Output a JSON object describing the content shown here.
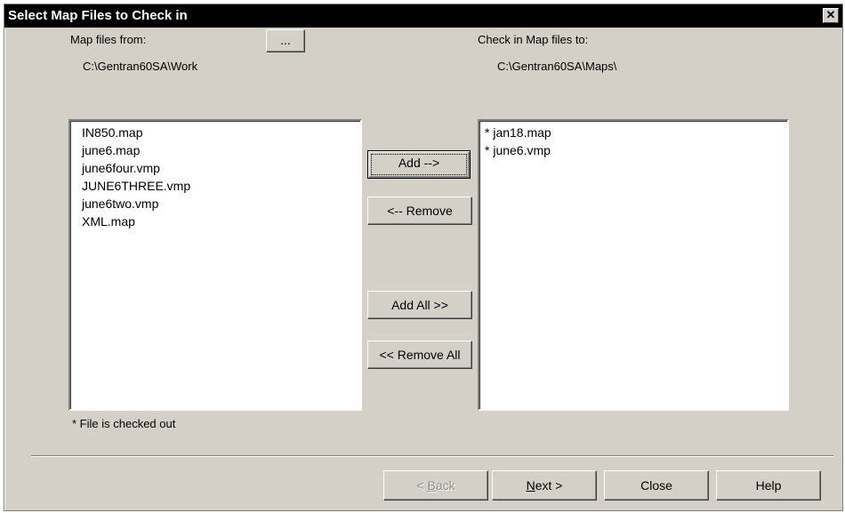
{
  "window": {
    "title": "Select Map Files to Check in",
    "close_glyph": "✕"
  },
  "source": {
    "label": "Map files from:",
    "browse_label": "...",
    "path": "C:\\Gentran60SA\\Work",
    "files": [
      "IN850.map",
      "june6.map",
      "june6four.vmp",
      "JUNE6THREE.vmp",
      "june6two.vmp",
      "XML.map"
    ]
  },
  "target": {
    "label": "Check in Map files to:",
    "path": "C:\\Gentran60SA\\Maps\\",
    "files": [
      "* jan18.map",
      "* june6.vmp"
    ]
  },
  "buttons": {
    "add": "Add -->",
    "remove": "<-- Remove",
    "add_all": "Add All  >>",
    "remove_all": "<< Remove All"
  },
  "footnote": "* File is checked out",
  "nav": {
    "back": "< Back",
    "next": "Next >",
    "close": "Close",
    "help": "Help"
  }
}
